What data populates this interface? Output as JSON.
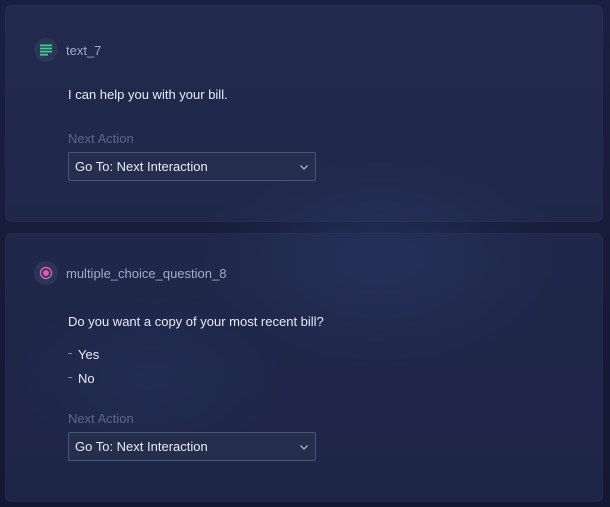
{
  "cards": [
    {
      "icon": "text-lines-icon",
      "title": "text_7",
      "prompt": "I can help you with your bill.",
      "next_action_label": "Next Action",
      "next_action_value": "Go To: Next Interaction"
    },
    {
      "icon": "radio-choice-icon",
      "title": "multiple_choice_question_8",
      "prompt": "Do you want a copy of your most recent bill?",
      "options": [
        "Yes",
        "No"
      ],
      "next_action_label": "Next Action",
      "next_action_value": "Go To: Next Interaction"
    }
  ],
  "colors": {
    "text_icon": "#3ecf8e",
    "choice_icon": "#e05ab8"
  }
}
